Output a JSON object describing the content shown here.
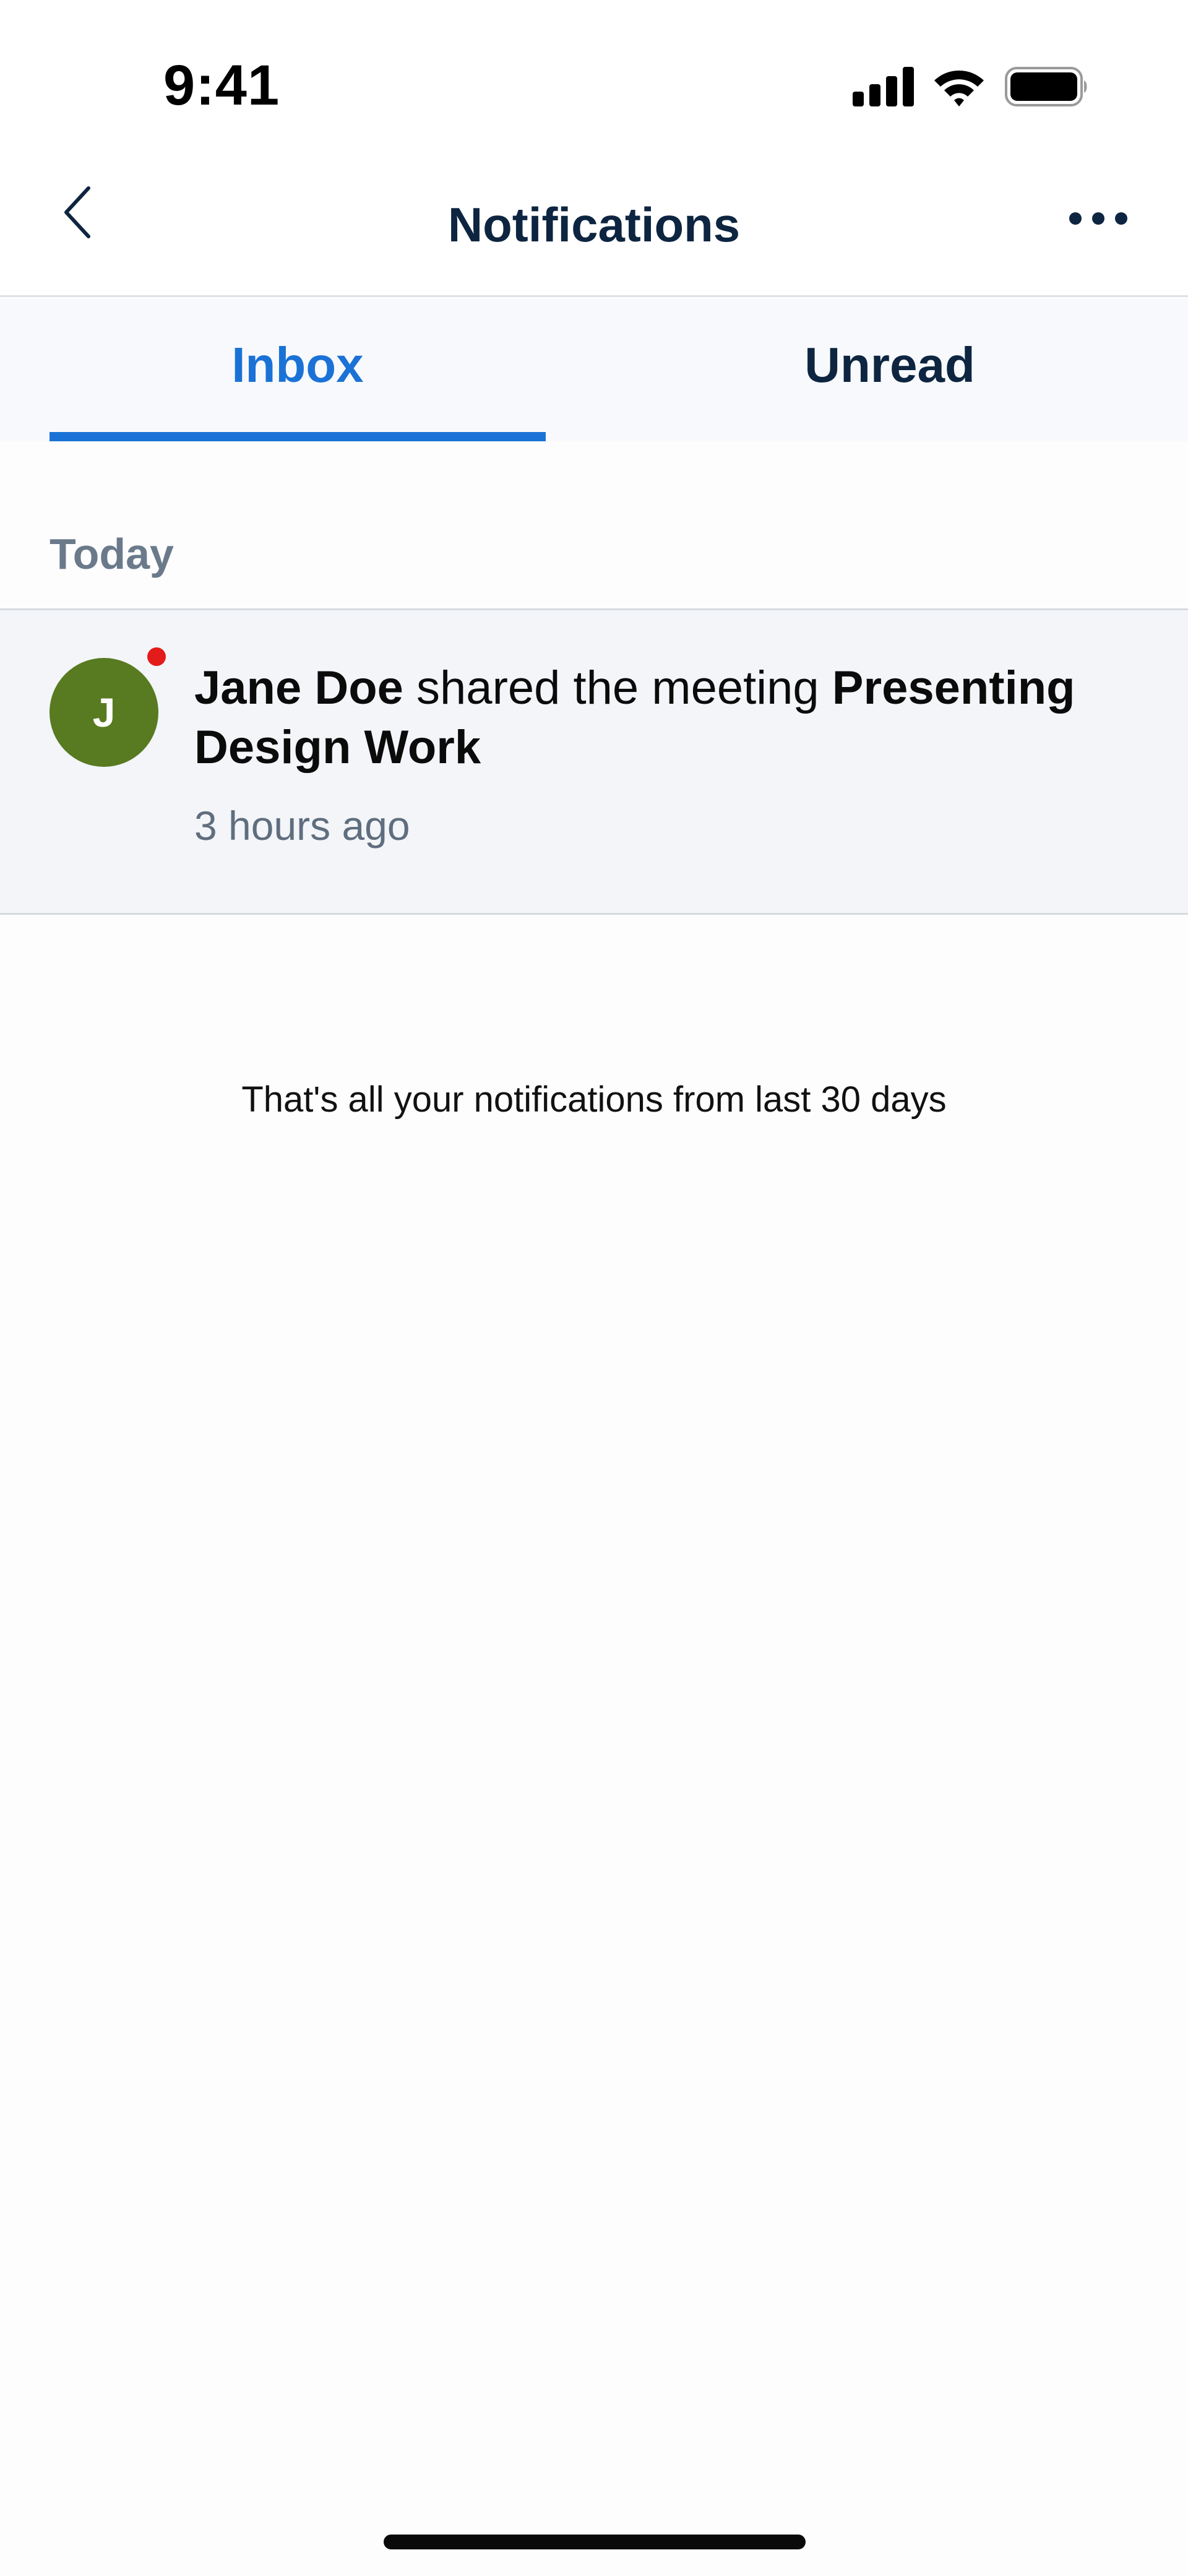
{
  "status_bar": {
    "time": "9:41"
  },
  "header": {
    "title": "Notifications",
    "back_icon": "chevron-left-icon",
    "more_icon": "ellipsis-icon"
  },
  "tabs": [
    {
      "label": "Inbox",
      "selected": true
    },
    {
      "label": "Unread",
      "selected": false
    }
  ],
  "sections": [
    {
      "label": "Today",
      "items": [
        {
          "avatar_initial": "J",
          "actor": "Jane Doe",
          "action": " shared the meeting ",
          "subject": "Presenting Design Work",
          "time": "3 hours ago",
          "unread": true
        }
      ]
    }
  ],
  "footer_note": "That's all your notifications from last 30 days",
  "colors": {
    "accent": "#1b72d6",
    "title": "#0d2540",
    "avatar_bg": "#587a20",
    "unread_dot": "#e31b1b",
    "item_bg": "#f3f5f9"
  }
}
